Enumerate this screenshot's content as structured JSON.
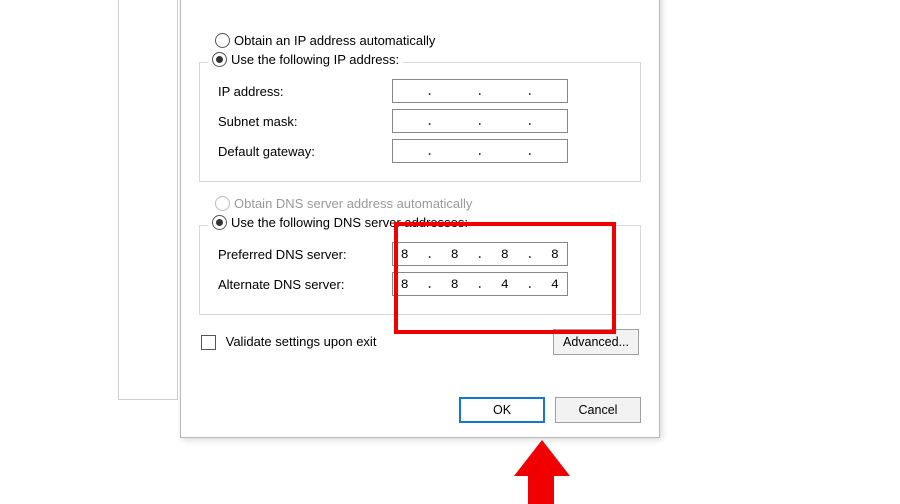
{
  "ip_group": {
    "auto_radio": "Obtain an IP address automatically",
    "manual_radio": "Use the following IP address:",
    "rows": {
      "ip_address": "IP address:",
      "subnet_mask": "Subnet mask:",
      "default_gateway": "Default gateway:"
    }
  },
  "dns_group": {
    "auto_radio": "Obtain DNS server address automatically",
    "manual_radio": "Use the following DNS server addresses:",
    "rows": {
      "preferred": "Preferred DNS server:",
      "alternate": "Alternate DNS server:"
    },
    "values": {
      "preferred": [
        "8",
        "8",
        "8",
        "8"
      ],
      "alternate": [
        "8",
        "8",
        "4",
        "4"
      ]
    }
  },
  "validate": "Validate settings upon exit",
  "buttons": {
    "advanced": "Advanced...",
    "ok": "OK",
    "cancel": "Cancel"
  }
}
